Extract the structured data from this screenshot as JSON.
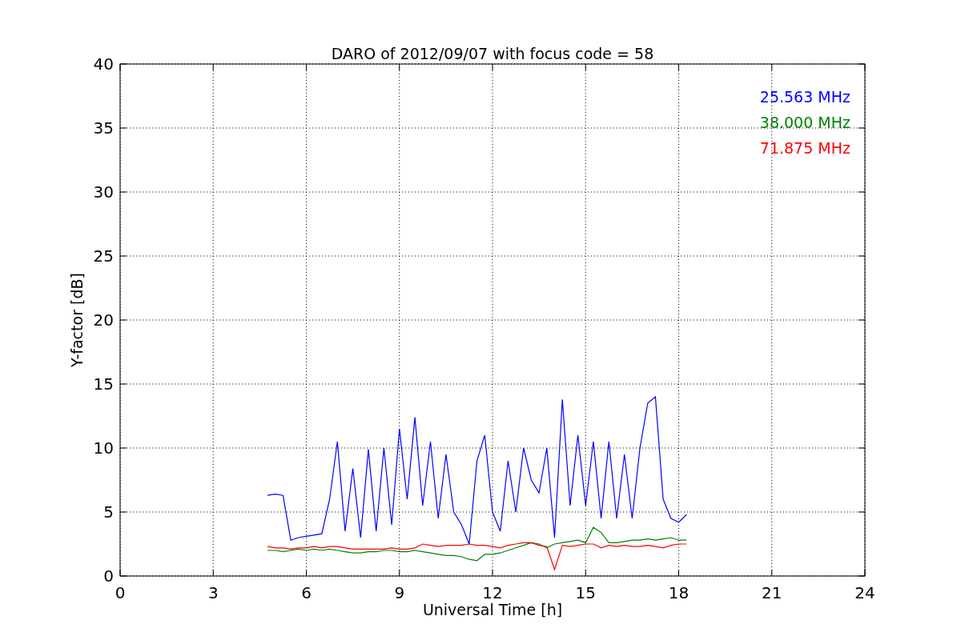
{
  "chart_data": {
    "type": "line",
    "title": "DARO of 2012/09/07 with focus code = 58",
    "xlabel": "Universal Time [h]",
    "ylabel": "Y-factor [dB]",
    "x": [
      4.75,
      5.0,
      5.25,
      5.5,
      5.75,
      6.0,
      6.25,
      6.5,
      6.75,
      7.0,
      7.25,
      7.5,
      7.75,
      8.0,
      8.25,
      8.5,
      8.75,
      9.0,
      9.25,
      9.5,
      9.75,
      10.0,
      10.25,
      10.5,
      10.75,
      11.0,
      11.25,
      11.5,
      11.75,
      12.0,
      12.25,
      12.5,
      12.75,
      13.0,
      13.25,
      13.5,
      13.75,
      14.0,
      14.25,
      14.5,
      14.75,
      15.0,
      15.25,
      15.5,
      15.75,
      16.0,
      16.25,
      16.5,
      16.75,
      17.0,
      17.25,
      17.5,
      17.75,
      18.0,
      18.25
    ],
    "series": [
      {
        "name": "25.563 MHz",
        "color": "#0000ff",
        "values": [
          6.3,
          6.4,
          6.3,
          2.8,
          3.0,
          3.1,
          3.2,
          3.3,
          6.0,
          10.5,
          3.5,
          8.4,
          3.0,
          9.9,
          3.5,
          10.0,
          4.0,
          11.5,
          6.0,
          12.4,
          5.5,
          10.5,
          4.5,
          9.5,
          5.0,
          4.0,
          2.5,
          9.0,
          11.0,
          5.0,
          3.5,
          9.0,
          5.0,
          10.0,
          7.5,
          6.5,
          10.0,
          3.0,
          13.8,
          5.5,
          11.0,
          5.5,
          10.5,
          4.5,
          10.5,
          4.5,
          9.5,
          4.5,
          10.0,
          13.5,
          14.0,
          6.0,
          4.5,
          4.2,
          4.8
        ]
      },
      {
        "name": "38.000 MHz",
        "color": "#008000",
        "values": [
          2.0,
          2.0,
          1.9,
          2.0,
          2.1,
          2.0,
          2.1,
          2.0,
          2.1,
          2.0,
          1.9,
          1.8,
          1.8,
          1.9,
          1.9,
          2.0,
          2.0,
          1.9,
          1.9,
          2.0,
          1.9,
          1.8,
          1.7,
          1.6,
          1.6,
          1.5,
          1.3,
          1.2,
          1.7,
          1.7,
          1.8,
          2.0,
          2.2,
          2.4,
          2.6,
          2.5,
          2.2,
          2.5,
          2.6,
          2.7,
          2.8,
          2.6,
          3.8,
          3.4,
          2.6,
          2.6,
          2.7,
          2.8,
          2.8,
          2.9,
          2.8,
          2.9,
          3.0,
          2.8,
          2.8
        ]
      },
      {
        "name": "71.875 MHz",
        "color": "#ff0000",
        "values": [
          2.3,
          2.2,
          2.2,
          2.1,
          2.2,
          2.2,
          2.3,
          2.2,
          2.3,
          2.3,
          2.2,
          2.1,
          2.1,
          2.1,
          2.1,
          2.1,
          2.2,
          2.1,
          2.1,
          2.2,
          2.5,
          2.4,
          2.3,
          2.4,
          2.4,
          2.4,
          2.5,
          2.4,
          2.4,
          2.3,
          2.2,
          2.4,
          2.5,
          2.6,
          2.6,
          2.4,
          2.3,
          0.5,
          2.4,
          2.3,
          2.4,
          2.5,
          2.5,
          2.2,
          2.4,
          2.3,
          2.4,
          2.3,
          2.3,
          2.4,
          2.3,
          2.2,
          2.4,
          2.5,
          2.5
        ]
      }
    ],
    "grid": true,
    "xlim": [
      0,
      24
    ],
    "ylim": [
      0,
      40
    ],
    "xticks": [
      0,
      3,
      6,
      9,
      12,
      15,
      18,
      21,
      24
    ],
    "yticks": [
      0,
      5,
      10,
      15,
      20,
      25,
      30,
      35,
      40
    ]
  }
}
